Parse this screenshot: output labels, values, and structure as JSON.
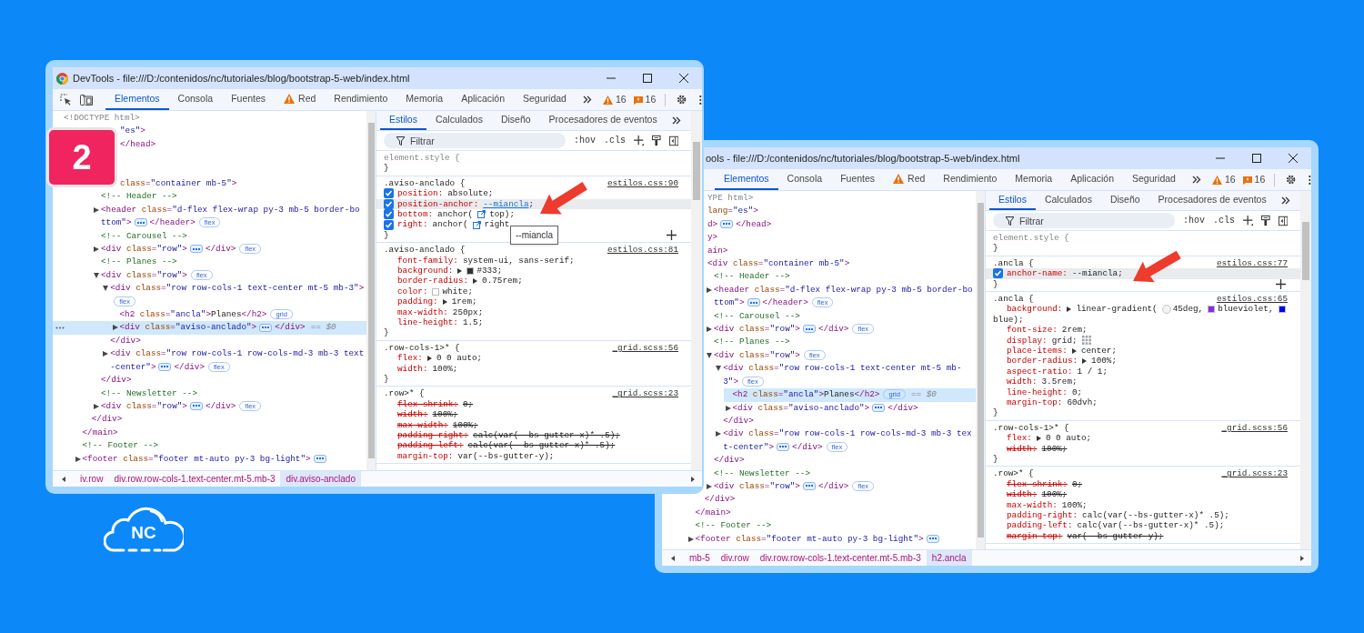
{
  "step_badge": "2",
  "logo": {
    "text": "NC"
  },
  "windows": [
    {
      "title": "DevTools - file:///D:/contenidos/nc/tutoriales/blog/bootstrap-5-web/index.html",
      "title_logo": true,
      "tool_icons": [
        {
          "kind": "inspect"
        },
        {
          "kind": "device"
        }
      ],
      "tabs": [
        {
          "label": "Elementos",
          "selected": true
        },
        {
          "label": "Consola",
          "selected": false
        },
        {
          "label": "Fuentes",
          "selected": false
        },
        {
          "label": "Red",
          "selected": false,
          "alert": true
        },
        {
          "label": "Rendimiento",
          "selected": false
        },
        {
          "label": "Memoria",
          "selected": false
        },
        {
          "label": "Aplicación",
          "selected": false
        },
        {
          "label": "Seguridad",
          "selected": false
        }
      ],
      "counters": [
        {
          "kind": "warning",
          "text": "16"
        },
        {
          "kind": "issue",
          "text": "16"
        }
      ],
      "tree": [
        {
          "kind": "doctype",
          "markup": "<!DOCTYPE html>",
          "selected": false
        },
        {
          "kind": "element",
          "cut_off": true,
          "markup": "\"es\">",
          "selected": false,
          "children": [
            {
              "kind": "element",
              "cut_off": true,
              "markup": "</head>",
              "selected": false
            },
            {
              "children": [
                {
                  "children": [
                    {
                      "kind": "element",
                      "cut_off": true,
                      "markup": "class=\"container mb-5\">",
                      "selected": false,
                      "end": "</div>",
                      "children": [
                        {
                          "kind": "comment",
                          "markup": "<!-- Header -->",
                          "selected": false
                        },
                        {
                          "kind": "element",
                          "markup": "<header class=\"d-flex flex-wrap py-3 mb-5 border-bottom\">",
                          "expanded": false,
                          "ellipsis": true,
                          "close": "</header>",
                          "badge": "flex",
                          "selected": false
                        },
                        {
                          "kind": "comment",
                          "markup": "<!-- Carousel -->",
                          "selected": false
                        },
                        {
                          "kind": "element",
                          "markup": "<div class=\"row\">",
                          "expanded": false,
                          "ellipsis": true,
                          "close": "</div>",
                          "badge": "flex",
                          "selected": false
                        },
                        {
                          "kind": "comment",
                          "markup": "<!-- Planes -->",
                          "selected": false
                        },
                        {
                          "kind": "element",
                          "markup": "<div class=\"row\">",
                          "expanded": true,
                          "badge": "flex",
                          "selected": false,
                          "end": "</div>",
                          "children": [
                            {
                              "kind": "element",
                              "markup": "<div class=\"row row-cols-1 text-center mt-5 mb-3\">",
                              "expanded": true,
                              "badge": "flex",
                              "selected": false,
                              "end": "</div>",
                              "children": [
                                {
                                  "kind": "element",
                                  "markup": "<h2 class=\"ancla\">Planes</h2>",
                                  "badge": "grid",
                                  "selected": false
                                },
                                {
                                  "kind": "element",
                                  "markup": "<div class=\"aviso-anclado\">",
                                  "expanded": false,
                                  "ellipsis": true,
                                  "close": "</div>",
                                  "marker": "== $0",
                                  "selected": true,
                                  "gutter_dots": true
                                }
                              ]
                            },
                            {
                              "kind": "element",
                              "markup": "<div class=\"row row-cols-1 row-cols-md-3 mb-3 text-center\">",
                              "expanded": false,
                              "ellipsis": true,
                              "close": "</div>",
                              "badge": "flex",
                              "selected": false
                            }
                          ]
                        },
                        {
                          "kind": "comment",
                          "markup": "<!-- Newsletter -->",
                          "selected": false
                        },
                        {
                          "kind": "element",
                          "markup": "<div class=\"row\">",
                          "expanded": false,
                          "ellipsis": true,
                          "close": "</div>",
                          "badge": "flex",
                          "selected": false
                        }
                      ]
                    }
                  ],
                  "end": "</main>"
                },
                {
                  "kind": "comment",
                  "markup": "<!-- Footer -->",
                  "selected": false
                },
                {
                  "kind": "element",
                  "markup": "<footer class=\"footer mt-auto py-3 bg-light\">",
                  "expanded": false,
                  "ellipsis": true,
                  "selected": false
                }
              ]
            }
          ]
        }
      ],
      "breadcrumbs": [
        {
          "label": "iv.row",
          "selected": false
        },
        {
          "label": "div.row.row-cols-1.text-center.mt-5.mb-3",
          "selected": false
        },
        {
          "label": "div.aviso-anclado",
          "selected": true
        }
      ],
      "styles": {
        "tabs": [
          {
            "label": "Estilos",
            "selected": true
          },
          {
            "label": "Calculados",
            "selected": false
          },
          {
            "label": "Diseño",
            "selected": false
          },
          {
            "label": "Procesadores de eventos",
            "selected": false
          }
        ],
        "filter_placeholder": "Filtrar",
        "toggles": [
          ":hov",
          ".cls"
        ],
        "rules": [
          {
            "kind": "inline",
            "selector": "element.style {",
            "close": "}"
          },
          {
            "kind": "stylesheet",
            "selector": ".aviso-anclado {",
            "source": "estilos.css:90",
            "close": "}",
            "add_button": true,
            "declarations": [
              {
                "property": "position:",
                "value": [
                  {
                    "kind": "text",
                    "text": "absolute;"
                  }
                ],
                "checked": true,
                "highlighted": false,
                "overridden": false
              },
              {
                "property": "position-anchor:",
                "value": [
                  {
                    "kind": "link",
                    "text": "--miancla"
                  },
                  {
                    "kind": "text",
                    "text": ";"
                  }
                ],
                "checked": true,
                "highlighted": true,
                "overridden": false
              },
              {
                "property": "bottom:",
                "value": [
                  {
                    "kind": "text",
                    "text": "anchor("
                  },
                  {
                    "kind": "anchor-icon"
                  },
                  {
                    "kind": "text",
                    "text": "top);"
                  }
                ],
                "checked": true,
                "highlighted": false,
                "overridden": false
              },
              {
                "property": "right:",
                "value": [
                  {
                    "kind": "text",
                    "text": "anchor("
                  },
                  {
                    "kind": "anchor-icon"
                  },
                  {
                    "kind": "text",
                    "text": "right"
                  }
                ],
                "checked": true,
                "highlighted": false,
                "overridden": false
              }
            ]
          },
          {
            "kind": "stylesheet",
            "selector": ".aviso-anclado {",
            "source": "estilos.css:81",
            "close": "}",
            "declarations": [
              {
                "property": "font-family:",
                "value": [
                  {
                    "kind": "text",
                    "text": "system-ui, sans-serif;"
                  }
                ],
                "overridden": false
              },
              {
                "property": "background:",
                "value": [
                  {
                    "kind": "expand"
                  },
                  {
                    "kind": "swatch",
                    "color": "#333333"
                  },
                  {
                    "kind": "text",
                    "text": "#333;"
                  }
                ],
                "overridden": false
              },
              {
                "property": "border-radius:",
                "value": [
                  {
                    "kind": "expand"
                  },
                  {
                    "kind": "text",
                    "text": "0.75rem;"
                  }
                ],
                "overridden": false
              },
              {
                "property": "color:",
                "value": [
                  {
                    "kind": "swatch",
                    "color": "#ffffff"
                  },
                  {
                    "kind": "text",
                    "text": "white;"
                  }
                ],
                "overridden": false
              },
              {
                "property": "padding:",
                "value": [
                  {
                    "kind": "expand"
                  },
                  {
                    "kind": "text",
                    "text": "1rem;"
                  }
                ],
                "overridden": false
              },
              {
                "property": "max-width:",
                "value": [
                  {
                    "kind": "text",
                    "text": "250px;"
                  }
                ],
                "overridden": false
              },
              {
                "property": "line-height:",
                "value": [
                  {
                    "kind": "text",
                    "text": "1.5;"
                  }
                ],
                "overridden": false
              }
            ]
          },
          {
            "kind": "stylesheet",
            "selector": ".row-cols-1>* {",
            "source": "_grid.scss:56",
            "close": "}",
            "declarations": [
              {
                "property": "flex:",
                "value": [
                  {
                    "kind": "expand"
                  },
                  {
                    "kind": "text",
                    "text": "0 0 auto;"
                  }
                ],
                "overridden": false
              },
              {
                "property": "width:",
                "value": [
                  {
                    "kind": "text",
                    "text": "100%;"
                  }
                ],
                "overridden": false
              }
            ]
          },
          {
            "kind": "stylesheet",
            "selector": ".row>* {",
            "source": "_grid.scss:23",
            "declarations": [
              {
                "property": "flex-shrink:",
                "value": [
                  {
                    "kind": "text",
                    "text": "0;"
                  }
                ],
                "overridden": true
              },
              {
                "property": "width:",
                "value": [
                  {
                    "kind": "text",
                    "text": "100%;"
                  }
                ],
                "overridden": true
              },
              {
                "property": "max-width:",
                "value": [
                  {
                    "kind": "text",
                    "text": "100%;"
                  }
                ],
                "overridden": true
              },
              {
                "property": "padding-right:",
                "value": [
                  {
                    "kind": "text",
                    "text": "calc(var(--bs-gutter-x)* .5);"
                  }
                ],
                "overridden": true
              },
              {
                "property": "padding-left:",
                "value": [
                  {
                    "kind": "text",
                    "text": "calc(var(--bs-gutter-x)* .5);"
                  }
                ],
                "overridden": true
              },
              {
                "property": "margin-top:",
                "value": [
                  {
                    "kind": "text",
                    "text": "var(--bs-gutter-y);"
                  }
                ],
                "overridden": false
              }
            ]
          }
        ]
      },
      "tooltip": {
        "text": "--miancla"
      }
    },
    {
      "title": "ools - file:///D:/contenidos/nc/tutoriales/blog/bootstrap-5-web/index.html",
      "tabs": [
        {
          "label": "Elementos",
          "selected": true
        },
        {
          "label": "Consola",
          "selected": false
        },
        {
          "label": "Fuentes",
          "selected": false
        },
        {
          "label": "Red",
          "selected": false,
          "alert": true
        },
        {
          "label": "Rendimiento",
          "selected": false
        },
        {
          "label": "Memoria",
          "selected": false
        },
        {
          "label": "Aplicación",
          "selected": false
        },
        {
          "label": "Seguridad",
          "selected": false
        }
      ],
      "counters": [
        {
          "kind": "warning",
          "text": "16"
        },
        {
          "kind": "issue",
          "text": "16"
        }
      ],
      "tree": [
        {
          "kind": "doctype",
          "cut_off": true,
          "markup": "YPE html>",
          "selected": false
        },
        {
          "kind": "element",
          "cut_off": true,
          "markup": "lang=\"es\">",
          "selected": false,
          "children": [
            {
              "kind": "element",
              "cut_off": true,
              "markup": "d>",
              "ellipsis": true,
              "close": "</head>",
              "selected": false
            },
            {
              "kind": "element",
              "cut_off": true,
              "markup": "y>",
              "selected": false,
              "children": [
                {
                  "kind": "element",
                  "cut_off": true,
                  "markup": "ain>",
                  "selected": false,
                  "end": "</main>",
                  "children": [
                    {
                      "kind": "element",
                      "cut_off": true,
                      "markup": "<div class=\"container mb-5\">",
                      "selected": false,
                      "end": "</div>",
                      "children": [
                        {
                          "kind": "comment",
                          "markup": "<!-- Header -->",
                          "selected": false
                        },
                        {
                          "kind": "element",
                          "markup": "<header class=\"d-flex flex-wrap py-3 mb-5 border-bottom\">",
                          "expanded": false,
                          "ellipsis": true,
                          "close": "</header>",
                          "badge": "flex",
                          "selected": false
                        },
                        {
                          "kind": "comment",
                          "markup": "<!-- Carousel -->",
                          "selected": false
                        },
                        {
                          "kind": "element",
                          "markup": "<div class=\"row\">",
                          "expanded": false,
                          "ellipsis": true,
                          "close": "</div>",
                          "badge": "flex",
                          "selected": false
                        },
                        {
                          "kind": "comment",
                          "markup": "<!-- Planes -->",
                          "selected": false
                        },
                        {
                          "kind": "element",
                          "markup": "<div class=\"row\">",
                          "expanded": true,
                          "badge": "flex",
                          "selected": false,
                          "end": "</div>",
                          "children": [
                            {
                              "kind": "element",
                              "markup": "<div class=\"row row-cols-1 text-center mt-5 mb-3\">",
                              "expanded": true,
                              "badge": "flex",
                              "selected": false,
                              "end": "</div>",
                              "children": [
                                {
                                  "kind": "element",
                                  "markup": "<h2 class=\"ancla\">Planes</h2>",
                                  "badge": "grid",
                                  "marker": "== $0",
                                  "selected": true
                                },
                                {
                                  "kind": "element",
                                  "markup": "<div class=\"aviso-anclado\">",
                                  "expanded": false,
                                  "ellipsis": true,
                                  "close": "</div>",
                                  "selected": false
                                }
                              ]
                            },
                            {
                              "kind": "element",
                              "markup": "<div class=\"row row-cols-1 row-cols-md-3 mb-3 text-center\">",
                              "expanded": false,
                              "ellipsis": true,
                              "close": "</div>",
                              "badge": "flex",
                              "selected": false
                            }
                          ]
                        },
                        {
                          "kind": "comment",
                          "markup": "<!-- Newsletter -->",
                          "selected": false
                        },
                        {
                          "kind": "element",
                          "markup": "<div class=\"row\">",
                          "expanded": false,
                          "ellipsis": true,
                          "close": "</div>",
                          "badge": "flex",
                          "selected": false
                        }
                      ]
                    }
                  ]
                },
                {
                  "kind": "comment",
                  "markup": "<!-- Footer -->",
                  "selected": false
                },
                {
                  "kind": "element",
                  "markup": "<footer class=\"footer mt-auto py-3 bg-light\">",
                  "expanded": false,
                  "ellipsis": true,
                  "selected": false
                }
              ]
            }
          ]
        }
      ],
      "breadcrumbs": [
        {
          "label": "mb-5",
          "selected": false
        },
        {
          "label": "div.row",
          "selected": false
        },
        {
          "label": "div.row.row-cols-1.text-center.mt-5.mb-3",
          "selected": false
        },
        {
          "label": "h2.ancla",
          "selected": true
        }
      ],
      "styles": {
        "tabs": [
          {
            "label": "Estilos",
            "selected": true
          },
          {
            "label": "Calculados",
            "selected": false
          },
          {
            "label": "Diseño",
            "selected": false
          },
          {
            "label": "Procesadores de eventos",
            "selected": false
          }
        ],
        "filter_placeholder": "Filtrar",
        "toggles": [
          ":hov",
          ".cls"
        ],
        "rules": [
          {
            "kind": "inline",
            "selector": "element.style {",
            "close": "}"
          },
          {
            "kind": "stylesheet",
            "selector": ".ancla {",
            "source": "estilos.css:77",
            "close": "}",
            "add_button": true,
            "declarations": [
              {
                "property": "anchor-name:",
                "value": [
                  {
                    "kind": "text",
                    "text": "--miancla;"
                  }
                ],
                "checked": true,
                "highlighted": true,
                "overridden": false
              }
            ]
          },
          {
            "kind": "stylesheet",
            "selector": ".ancla {",
            "source": "estilos.css:65",
            "close": "}",
            "declarations": [
              {
                "property": "background:",
                "value": [
                  {
                    "kind": "expand"
                  },
                  {
                    "kind": "text",
                    "text": "linear-gradient("
                  },
                  {
                    "kind": "angle-icon"
                  },
                  {
                    "kind": "text",
                    "text": "45deg,"
                  },
                  {
                    "kind": "swatch",
                    "color": "#8a2be2"
                  },
                  {
                    "kind": "text",
                    "text": "blueviolet,"
                  },
                  {
                    "kind": "swatch",
                    "color": "#0000ff"
                  },
                  {
                    "kind": "text",
                    "text": "blue);"
                  }
                ],
                "overridden": false
              },
              {
                "property": "font-size:",
                "value": [
                  {
                    "kind": "text",
                    "text": "2rem;"
                  }
                ],
                "overridden": false
              },
              {
                "property": "display:",
                "value": [
                  {
                    "kind": "text",
                    "text": "grid;"
                  },
                  {
                    "kind": "grid-icon"
                  }
                ],
                "overridden": false
              },
              {
                "property": "place-items:",
                "value": [
                  {
                    "kind": "expand"
                  },
                  {
                    "kind": "text",
                    "text": "center;"
                  }
                ],
                "overridden": false
              },
              {
                "property": "border-radius:",
                "value": [
                  {
                    "kind": "expand"
                  },
                  {
                    "kind": "text",
                    "text": "100%;"
                  }
                ],
                "overridden": false
              },
              {
                "property": "aspect-ratio:",
                "value": [
                  {
                    "kind": "text",
                    "text": "1 / 1;"
                  }
                ],
                "overridden": false
              },
              {
                "property": "width:",
                "value": [
                  {
                    "kind": "text",
                    "text": "3.5rem;"
                  }
                ],
                "overridden": false
              },
              {
                "property": "line-height:",
                "value": [
                  {
                    "kind": "text",
                    "text": "0;"
                  }
                ],
                "overridden": false
              },
              {
                "property": "margin-top:",
                "value": [
                  {
                    "kind": "text",
                    "text": "60dvh;"
                  }
                ],
                "overridden": false
              }
            ]
          },
          {
            "kind": "stylesheet",
            "selector": ".row-cols-1>* {",
            "source": "_grid.scss:56",
            "close": "}",
            "declarations": [
              {
                "property": "flex:",
                "value": [
                  {
                    "kind": "expand"
                  },
                  {
                    "kind": "text",
                    "text": "0 0 auto;"
                  }
                ],
                "overridden": false
              },
              {
                "property": "width:",
                "value": [
                  {
                    "kind": "text",
                    "text": "100%;"
                  }
                ],
                "overridden": true
              }
            ]
          },
          {
            "kind": "stylesheet",
            "selector": ".row>* {",
            "source": "_grid.scss:23",
            "declarations": [
              {
                "property": "flex-shrink:",
                "value": [
                  {
                    "kind": "text",
                    "text": "0;"
                  }
                ],
                "overridden": true
              },
              {
                "property": "width:",
                "value": [
                  {
                    "kind": "text",
                    "text": "100%;"
                  }
                ],
                "overridden": true
              },
              {
                "property": "max-width:",
                "value": [
                  {
                    "kind": "text",
                    "text": "100%;"
                  }
                ],
                "overridden": false
              },
              {
                "property": "padding-right:",
                "value": [
                  {
                    "kind": "text",
                    "text": "calc(var(--bs-gutter-x)* .5);"
                  }
                ],
                "overridden": false
              },
              {
                "property": "padding-left:",
                "value": [
                  {
                    "kind": "text",
                    "text": "calc(var(--bs-gutter-x)* .5);"
                  }
                ],
                "overridden": false
              },
              {
                "property": "margin-top:",
                "value": [
                  {
                    "kind": "text",
                    "text": "var(--bs-gutter-y);"
                  }
                ],
                "overridden": true
              }
            ]
          }
        ]
      }
    }
  ]
}
